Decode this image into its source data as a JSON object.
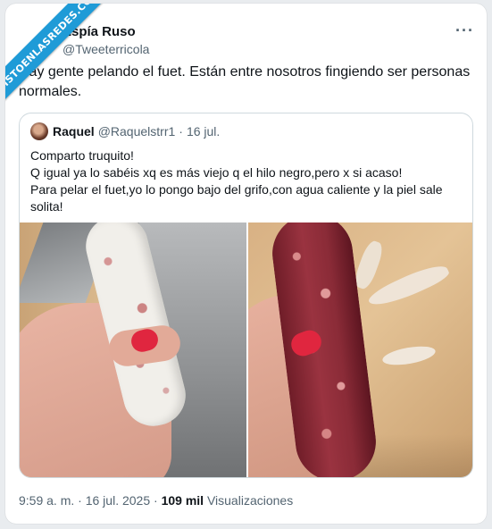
{
  "watermark": "VISTOENLASREDES.COM",
  "tweet": {
    "display_name": "Espía Ruso",
    "handle": "@Tweeterricola",
    "more_icon": "···",
    "text": "Hay gente pelando el fuet. Están entre nosotros fingiendo ser personas normales."
  },
  "quote": {
    "display_name": "Raquel",
    "handle": "@Raquelstrr1",
    "separator": "·",
    "date": "16 jul.",
    "lines": [
      "Comparto truquito!",
      "Q igual ya lo sabéis xq es más viejo q el hilo negro,pero x si acaso!",
      "Para pelar el fuet,yo lo pongo bajo del grifo,con agua caliente y la piel sale",
      "solita!"
    ]
  },
  "footer": {
    "time": "9:59 a. m.",
    "separator1": "·",
    "date": "16 jul. 2025",
    "separator2": "·",
    "views_count": "109 mil",
    "views_label": "Visualizaciones"
  },
  "colors": {
    "accent_ribbon": "#1f9bd7",
    "secondary_text": "#536471",
    "border": "#cfd9de",
    "nail_polish": "#e0263f"
  }
}
